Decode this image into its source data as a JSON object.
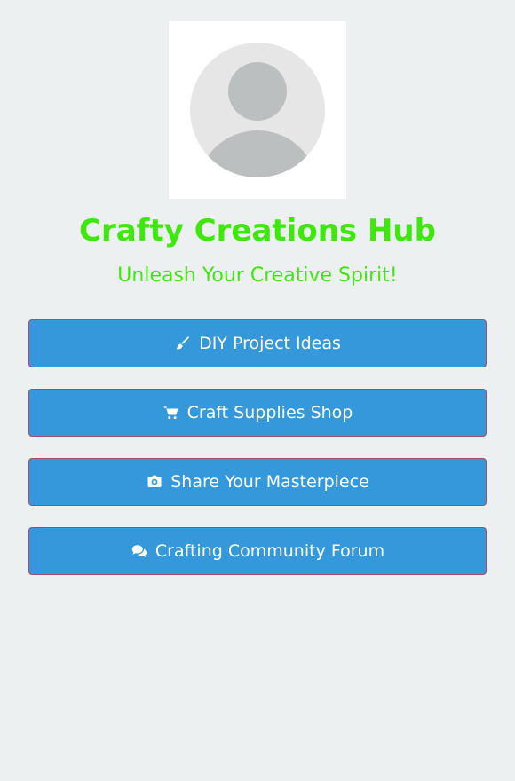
{
  "profile": {
    "title": "Crafty Creations Hub",
    "subtitle": "Unleash Your Creative Spirit!"
  },
  "links": [
    {
      "label": "DIY Project Ideas",
      "icon": "paintbrush-icon"
    },
    {
      "label": "Craft Supplies Shop",
      "icon": "shopping-cart-icon"
    },
    {
      "label": "Share Your Masterpiece",
      "icon": "camera-icon"
    },
    {
      "label": "Crafting Community Forum",
      "icon": "comments-icon"
    }
  ],
  "colors": {
    "background": "#ecf0f1",
    "accent_text": "#3ee80c",
    "button_bg": "#3498db",
    "button_text": "#ffffff"
  }
}
